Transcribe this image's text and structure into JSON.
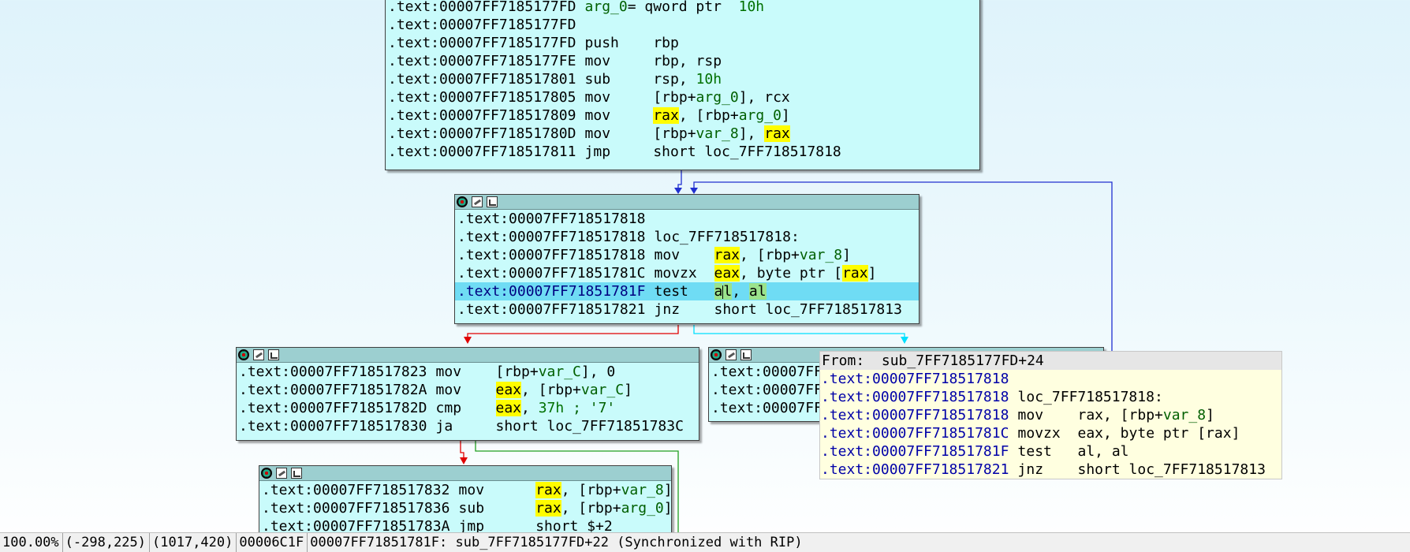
{
  "block1": {
    "lines": [
      {
        "addr": ".text:00007FF7185177FD",
        "rest": "arg_0= qword ptr  10h"
      },
      {
        "addr": ".text:00007FF7185177FD",
        "rest": ""
      },
      {
        "addr": ".text:00007FF7185177FD",
        "mn": "push",
        "op": "rbp"
      },
      {
        "addr": ".text:00007FF7185177FE",
        "mn": "mov",
        "op": "rbp, rsp"
      },
      {
        "addr": ".text:00007FF718517801",
        "mn": "sub",
        "op": "rsp, 10h"
      },
      {
        "addr": ".text:00007FF718517805",
        "mn": "mov",
        "op": "[rbp+arg_0], rcx"
      },
      {
        "addr": ".text:00007FF718517809",
        "mn": "mov",
        "op": "rax, [rbp+arg_0]"
      },
      {
        "addr": ".text:00007FF71851780D",
        "mn": "mov",
        "op": "[rbp+var_8], rax"
      },
      {
        "addr": ".text:00007FF718517811",
        "mn": "jmp",
        "op": "short loc_7FF718517818"
      }
    ]
  },
  "block2": {
    "lines": [
      {
        "addr": ".text:00007FF718517818",
        "rest": ""
      },
      {
        "addr": ".text:00007FF718517818",
        "rest": "loc_7FF718517818:"
      },
      {
        "addr": ".text:00007FF718517818",
        "mn": "mov",
        "op": "rax, [rbp+var_8]"
      },
      {
        "addr": ".text:00007FF71851781C",
        "mn": "movzx",
        "op": "eax, byte ptr [rax]"
      },
      {
        "addr": ".text:00007FF71851781F",
        "mn": "test",
        "op": "al, al"
      },
      {
        "addr": ".text:00007FF718517821",
        "mn": "jnz",
        "op": "short loc_7FF718517813"
      }
    ]
  },
  "block3": {
    "lines": [
      {
        "addr": ".text:00007FF718517823",
        "mn": "mov",
        "op": "[rbp+var_C], 0"
      },
      {
        "addr": ".text:00007FF71851782A",
        "mn": "mov",
        "op": "eax, [rbp+var_C]"
      },
      {
        "addr": ".text:00007FF71851782D",
        "mn": "cmp",
        "op": "eax, 37h ; '7'"
      },
      {
        "addr": ".text:00007FF718517830",
        "mn": "ja",
        "op": "short loc_7FF71851783C"
      }
    ]
  },
  "block4": {
    "lines": [
      {
        "addr": ".text:00007FF718517832",
        "mn": "mov",
        "op": "rax, [rbp+var_8]"
      },
      {
        "addr": ".text:00007FF718517836",
        "mn": "sub",
        "op": "rax, [rbp+arg_0]"
      },
      {
        "addr": ".text:00007FF71851783A",
        "mn": "jmp",
        "op": "short $+2"
      }
    ]
  },
  "block5": {
    "lines": [
      {
        "addr": ".text:00007FF"
      },
      {
        "addr": ".text:00007FF"
      },
      {
        "addr": ".text:00007FF"
      }
    ]
  },
  "tooltip": {
    "title": "From:  sub_7FF7185177FD+24",
    "lines": [
      {
        "addr": ".text:00007FF718517818",
        "rest": ""
      },
      {
        "addr": ".text:00007FF718517818",
        "rest": "loc_7FF718517818:"
      },
      {
        "addr": ".text:00007FF718517818",
        "mn": "mov",
        "op": "rax, [rbp+var_8]"
      },
      {
        "addr": ".text:00007FF71851781C",
        "mn": "movzx",
        "op": "eax, byte ptr [rax]"
      },
      {
        "addr": ".text:00007FF71851781F",
        "mn": "test",
        "op": "al, al"
      },
      {
        "addr": ".text:00007FF718517821",
        "mn": "jnz",
        "op": "short loc_7FF718517813"
      }
    ]
  },
  "status": {
    "zoom": "100.00%",
    "mouse": "(-298,225)",
    "graph_pos": "(1017,420)",
    "offset": "00006C1F",
    "location": "00007FF71851781F: sub_7FF7185177FD+22 (Synchronized with RIP)"
  },
  "colors": {
    "node_bg": "#c9fbfb",
    "node_header": "#9ccfd0",
    "selected_line": "#6fdcf4",
    "register_highlight": "#fffd00",
    "edge_true": "#00e0ff",
    "edge_false": "#e00000",
    "edge_jump": "#2030d0",
    "edge_green": "#20a020"
  },
  "icons": [
    "node-color-icon",
    "node-rename-icon",
    "node-graph-icon"
  ]
}
